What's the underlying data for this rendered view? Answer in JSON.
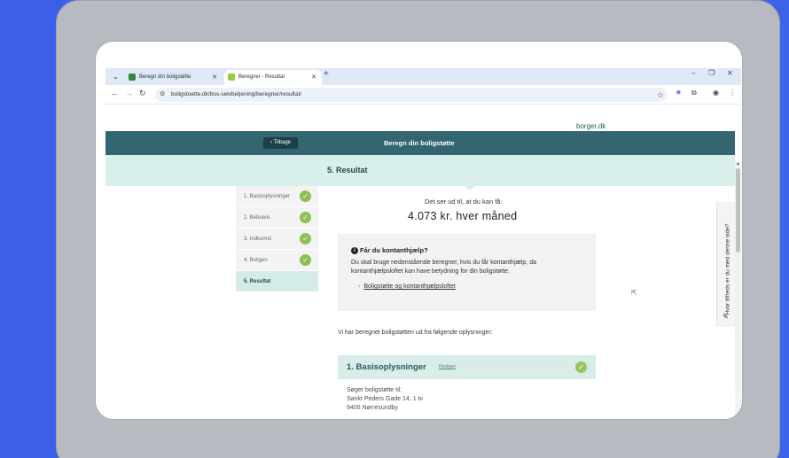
{
  "browser": {
    "tabs": [
      {
        "label": "Beregn din boligstøtte",
        "active": false
      },
      {
        "label": "Beregner - Resultat",
        "active": true
      }
    ],
    "url": "boligstoette.dk/bos-selvbetjening/beregner/resultat/",
    "colors": {
      "tabbar": "#dfe8f7",
      "omnibox": "#edf2fa"
    }
  },
  "page": {
    "brand": "borger.dk",
    "back_label": "Tilbage",
    "header_title": "Beregn din boligstøtte",
    "step_title": "5. Resultat",
    "steps": [
      {
        "label": "1. Basisoplysninger",
        "done": true
      },
      {
        "label": "2. Beboere",
        "done": true
      },
      {
        "label": "3. Indkomst",
        "done": true
      },
      {
        "label": "4. Boligen",
        "done": true
      },
      {
        "label": "5. Resultat",
        "done": false
      }
    ],
    "result_intro": "Det ser ud til, at du kan få:",
    "result_amount": "4.073 kr. hver måned",
    "info": {
      "title": "Får du kontanthjælp?",
      "text": "Du skal bruge nedenstående beregner, hvis du får kontanthjælp, da kontanthjælpsloftet kan have betydning for din boligstøtte.",
      "link": "Boligstøtte og kontanthjælpsloftet"
    },
    "summary_intro": "Vi har beregnet boligstøtten ud fra følgende oplysninger:",
    "section": {
      "title": "1. Basisoplysninger",
      "edit_label": "Rediger",
      "lines": [
        "Søger boligstøtte til:",
        "Sankt Peders Gade 14, 1 tv",
        "9400 Nørresundby"
      ]
    },
    "feedback_label": "Hvor tilfreds er du med denne side?",
    "colors": {
      "header": "#336670",
      "step_band": "#d9efeb",
      "check": "#8fbf55"
    }
  }
}
